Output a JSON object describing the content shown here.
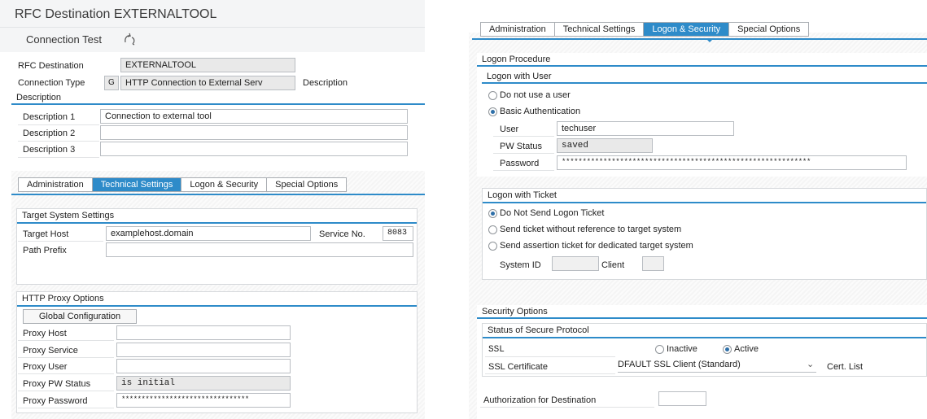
{
  "left": {
    "title": "RFC Destination EXTERNALTOOL",
    "toolbar": {
      "connection_test": "Connection Test"
    },
    "header": {
      "rfc_destination_label": "RFC Destination",
      "rfc_destination_value": "EXTERNALTOOL",
      "connection_type_label": "Connection Type",
      "connection_type_code": "G",
      "connection_type_value": "HTTP Connection to External Serv",
      "description_label": "Description"
    },
    "description": {
      "section_title": "Description",
      "d1_label": "Description 1",
      "d1_value": "Connection to external tool",
      "d2_label": "Description 2",
      "d2_value": "",
      "d3_label": "Description 3",
      "d3_value": ""
    },
    "tabs": [
      "Administration",
      "Technical Settings",
      "Logon & Security",
      "Special Options"
    ],
    "target": {
      "section_title": "Target System Settings",
      "host_label": "Target Host",
      "host_value": "examplehost.domain",
      "service_label": "Service No.",
      "service_value": "8083",
      "path_label": "Path Prefix",
      "path_value": ""
    },
    "proxy": {
      "section_title": "HTTP Proxy Options",
      "global_button": "Global Configuration",
      "host_label": "Proxy Host",
      "service_label": "Proxy Service",
      "user_label": "Proxy User",
      "pw_status_label": "Proxy PW Status",
      "pw_status_value": "is initial",
      "password_label": "Proxy Password",
      "password_value": "********************************"
    }
  },
  "right": {
    "tabs": [
      "Administration",
      "Technical Settings",
      "Logon & Security",
      "Special Options"
    ],
    "logon_procedure": {
      "title": "Logon Procedure",
      "logon_with_user": "Logon with User",
      "do_not_use_user": "Do not use a user",
      "basic_auth": "Basic Authentication",
      "user_label": "User",
      "user_value": "techuser",
      "pw_status_label": "PW Status",
      "pw_status_value": "saved",
      "password_label": "Password",
      "password_value": "************************************************************"
    },
    "ticket": {
      "title": "Logon with Ticket",
      "do_not_send": "Do Not Send Logon Ticket",
      "send_without_ref": "Send ticket without reference to target system",
      "send_assertion": "Send assertion ticket for dedicated target system",
      "system_id_label": "System ID",
      "client_label": "Client"
    },
    "security": {
      "title": "Security Options",
      "secure_protocol_title": "Status of Secure Protocol",
      "ssl_label": "SSL",
      "inactive": "Inactive",
      "active": "Active",
      "ssl_cert_label": "SSL Certificate",
      "ssl_cert_value": "DFAULT SSL Client (Standard)",
      "cert_list": "Cert. List",
      "auth_label": "Authorization for Destination"
    }
  }
}
